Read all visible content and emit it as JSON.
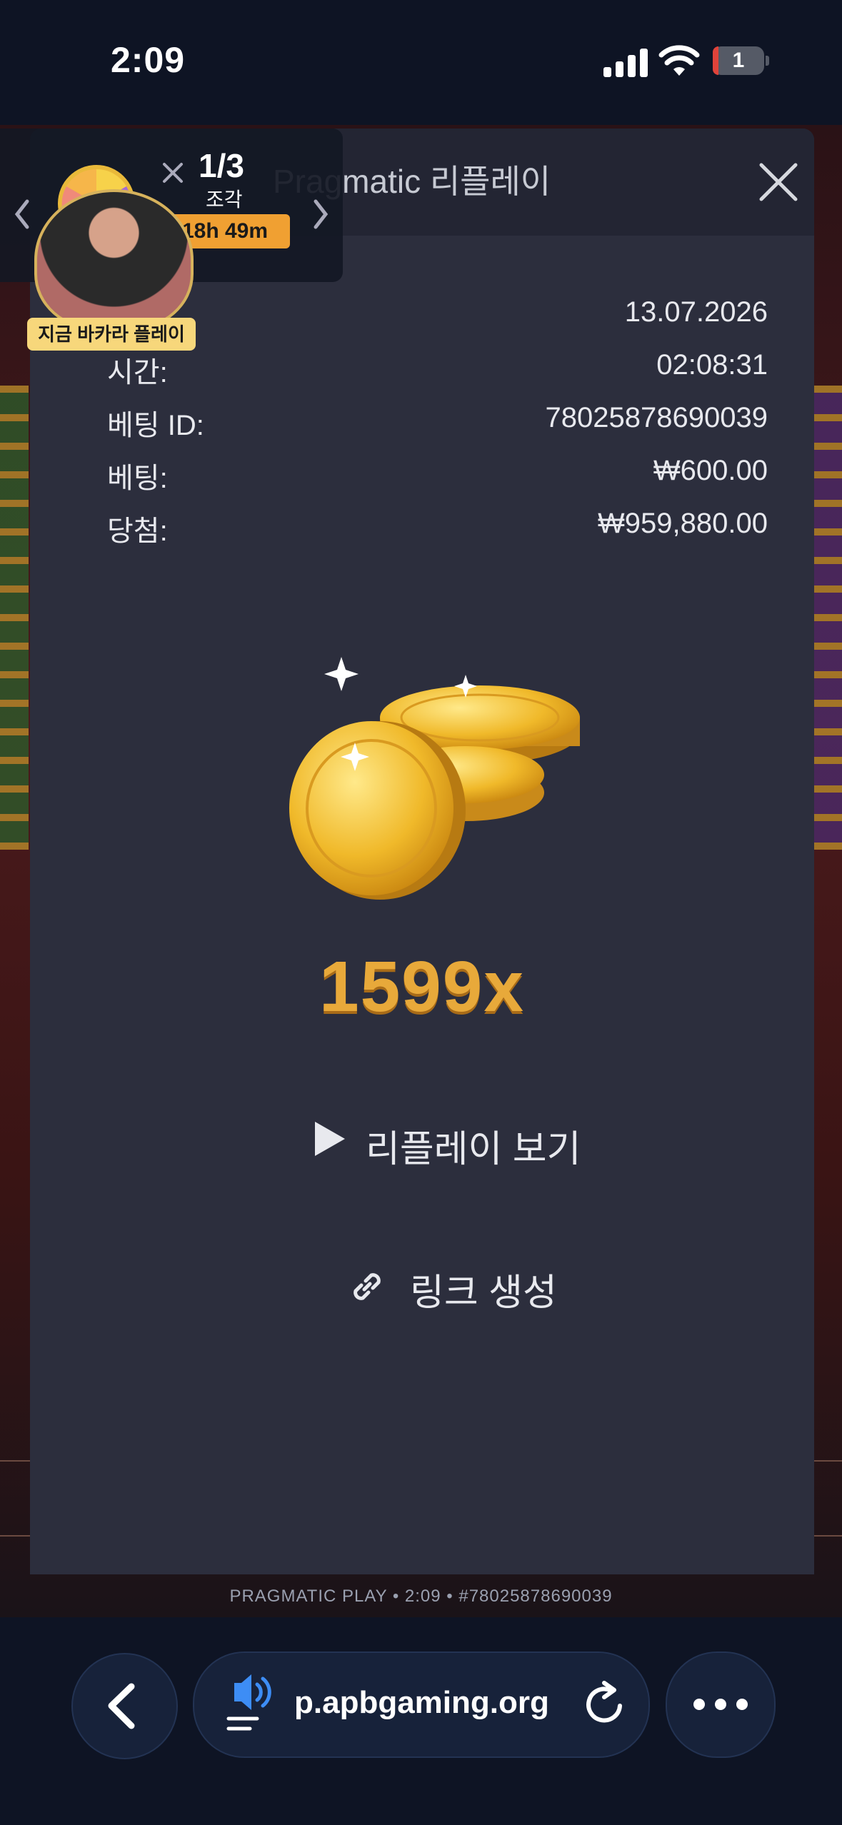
{
  "status_bar": {
    "time": "2:09",
    "battery_level": "1"
  },
  "game_footer": {
    "info": "PRAGMATIC PLAY • 2:09 • #78025878690039"
  },
  "modal": {
    "title": "Pragmatic 리플레이",
    "rows": [
      {
        "label": "",
        "value": "13.07.2026"
      },
      {
        "label": "시간:",
        "value": "02:08:31"
      },
      {
        "label": "베팅 ID:",
        "value": "78025878690039"
      },
      {
        "label": "베팅:",
        "value": "₩600.00"
      },
      {
        "label": "당첨:",
        "value": "₩959,880.00"
      }
    ],
    "multiplier": "1599x",
    "replay_label": "리플레이 보기",
    "link_label": "링크 생성"
  },
  "promo": {
    "count": "1/3",
    "sub": "조각",
    "timer": "18h 49m",
    "baccarat_label": "지금 바카라 플레이"
  },
  "browser": {
    "url": "p.apbgaming.org"
  },
  "colors": {
    "modal_bg": "#2c2e3d",
    "accent_gold": "#e8a93a",
    "timer_orange": "#f0a032",
    "sound_blue": "#3d8df5"
  }
}
